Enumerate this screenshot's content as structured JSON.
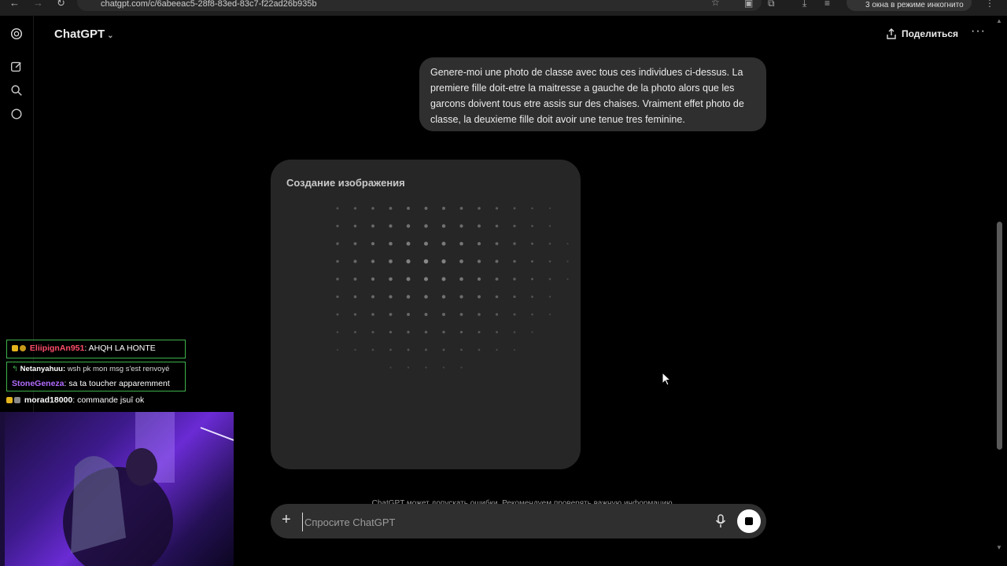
{
  "browser": {
    "url": "chatgpt.com/c/6abeeac5-28f8-83ed-83c7-f22ad26b935b",
    "incognito_label": "3 окна в режиме инкогнито"
  },
  "header": {
    "title": "ChatGPT",
    "share_label": "Поделиться"
  },
  "conversation": {
    "user_message": "Genere-moi une photo de classe avec tous ces individues ci-dessus. La premiere fille doit-etre la maitresse a gauche de la photo alors que les garcons doivent tous etre assis sur des chaises. Vraiment effet photo de classe, la deuxieme fille doit avoir une tenue tres feminine.",
    "image_status": "Создание изображения"
  },
  "disclaimer": "ChatGPT может допускать ошибки. Рекомендуем проверять важную информацию.",
  "composer": {
    "placeholder": "Спросите ChatGPT"
  },
  "stream_chat": [
    {
      "user": "EliipignAn951",
      "sep": ":",
      "text": "AHQH LA HONTE",
      "user_color": "#ff4d6a"
    },
    {
      "reply_to": "Netanyahuu:",
      "reply_text": "wsh pk mon msg s'est renvoyé",
      "user": "StoneGeneza",
      "sep": ":",
      "text": "sa ta toucher apparemment",
      "user_color": "#b36bff"
    },
    {
      "user": "morad18000",
      "sep": ":",
      "text": "commande jsuî ok",
      "user_color": "#ffffff"
    }
  ],
  "colors": {
    "background": "#000000",
    "bubble": "#2f2f2f",
    "card": "#262626",
    "chat_border": "#3fb24b"
  }
}
